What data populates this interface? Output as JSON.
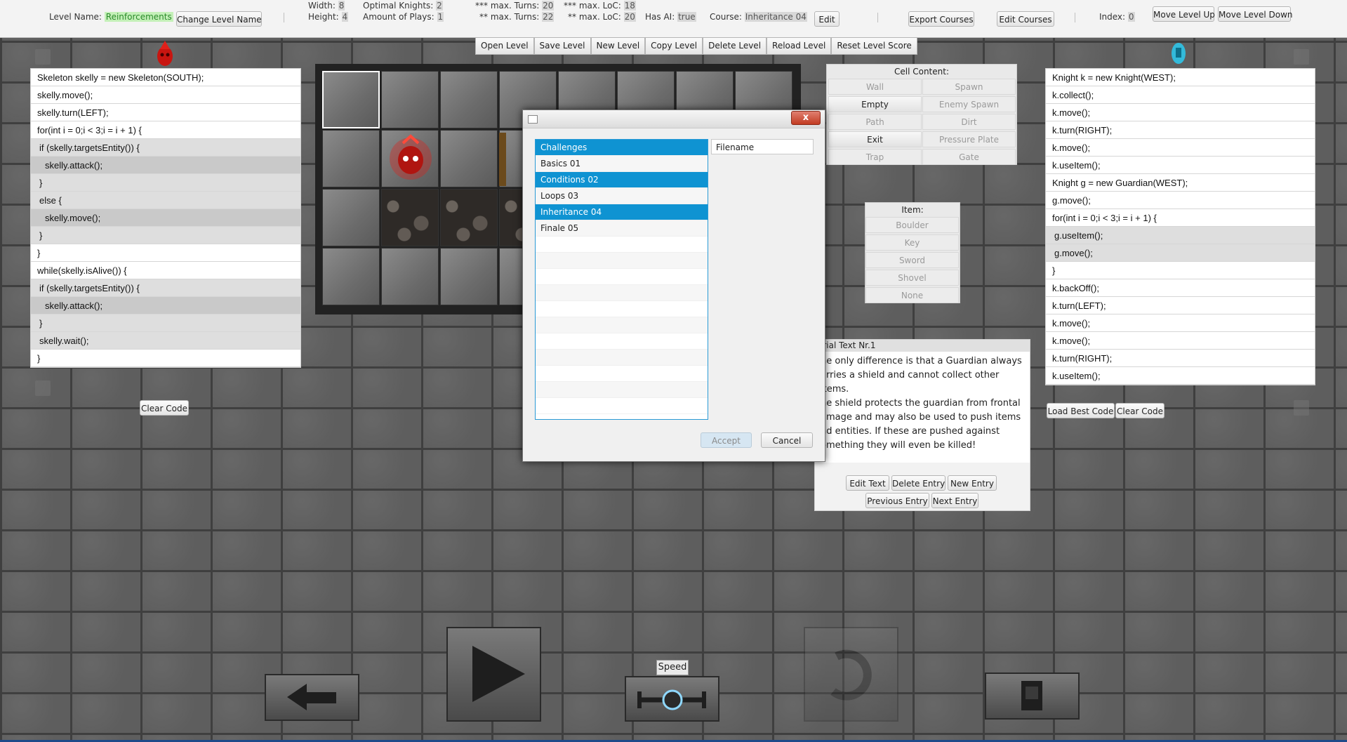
{
  "topbar": {
    "level_name_label": "Level Name:",
    "level_name_value": "Reinforcements",
    "change_level_name": "Change Level Name",
    "width_label": "Width:",
    "width_value": "8",
    "height_label": "Height:",
    "height_value": "4",
    "optimal_knights_label": "Optimal Knights:",
    "optimal_knights_value": "2",
    "amount_plays_label": "Amount of Plays:",
    "amount_plays_value": "1",
    "max_turns3_label": "*** max. Turns:",
    "max_turns3_value": "20",
    "max_turns2_label": "** max. Turns:",
    "max_turns2_value": "22",
    "max_loc3_label": "*** max. LoC:",
    "max_loc3_value": "18",
    "max_loc2_label": "** max. LoC:",
    "max_loc2_value": "20",
    "has_ai_label": "Has AI:",
    "has_ai_value": "true",
    "course_label": "Course:",
    "course_value": "Inheritance 04",
    "edit": "Edit",
    "export_courses": "Export Courses",
    "edit_courses": "Edit Courses",
    "index_label": "Index:",
    "index_value": "0",
    "move_level_up": "Move Level Up",
    "move_level_down": "Move Level Down"
  },
  "toolbar": [
    "Open Level",
    "Save Level",
    "New Level",
    "Copy Level",
    "Delete Level",
    "Reload Level",
    "Reset Level Score"
  ],
  "left_code": [
    {
      "text": "Skeleton skelly = new Skeleton(SOUTH);",
      "indent": 0
    },
    {
      "text": "skelly.move();",
      "indent": 0
    },
    {
      "text": "skelly.turn(LEFT);",
      "indent": 0
    },
    {
      "text": "for(int i = 0;i < 3;i = i + 1) {",
      "indent": 0
    },
    {
      "text": "if (skelly.targetsEntity()) {",
      "indent": 1
    },
    {
      "text": "skelly.attack();",
      "indent": 2
    },
    {
      "text": "}",
      "indent": 1
    },
    {
      "text": "else {",
      "indent": 1
    },
    {
      "text": "skelly.move();",
      "indent": 2
    },
    {
      "text": "}",
      "indent": 1
    },
    {
      "text": "}",
      "indent": 0
    },
    {
      "text": "while(skelly.isAlive()) {",
      "indent": 0
    },
    {
      "text": "if (skelly.targetsEntity()) {",
      "indent": 1
    },
    {
      "text": "skelly.attack();",
      "indent": 2
    },
    {
      "text": "}",
      "indent": 1
    },
    {
      "text": "skelly.wait();",
      "indent": 1
    },
    {
      "text": "}",
      "indent": 0
    }
  ],
  "left_clear_code": "Clear Code",
  "right_code": [
    {
      "text": "Knight k = new Knight(WEST);",
      "indent": 0
    },
    {
      "text": "k.collect();",
      "indent": 0
    },
    {
      "text": "k.move();",
      "indent": 0
    },
    {
      "text": "k.turn(RIGHT);",
      "indent": 0
    },
    {
      "text": "k.move();",
      "indent": 0
    },
    {
      "text": "k.useItem();",
      "indent": 0
    },
    {
      "text": "Knight g = new Guardian(WEST);",
      "indent": 0
    },
    {
      "text": "g.move();",
      "indent": 0
    },
    {
      "text": "for(int i = 0;i < 3;i = i + 1) {",
      "indent": 0
    },
    {
      "text": "g.useItem();",
      "indent": 1
    },
    {
      "text": "g.move();",
      "indent": 1
    },
    {
      "text": "}",
      "indent": 0
    },
    {
      "text": "k.backOff();",
      "indent": 0
    },
    {
      "text": "k.turn(LEFT);",
      "indent": 0
    },
    {
      "text": "k.move();",
      "indent": 0
    },
    {
      "text": "k.move();",
      "indent": 0
    },
    {
      "text": "k.turn(RIGHT);",
      "indent": 0
    },
    {
      "text": "k.useItem();",
      "indent": 0
    }
  ],
  "load_best_code": "Load Best Code",
  "right_clear_code": "Clear Code",
  "cell_content": {
    "title": "Cell Content:",
    "buttons": [
      {
        "label": "Wall",
        "active": false
      },
      {
        "label": "Spawn",
        "active": false
      },
      {
        "label": "Empty",
        "active": true
      },
      {
        "label": "Enemy Spawn",
        "active": false
      },
      {
        "label": "Path",
        "active": false
      },
      {
        "label": "Dirt",
        "active": false
      },
      {
        "label": "Exit",
        "active": true
      },
      {
        "label": "Pressure Plate",
        "active": false
      },
      {
        "label": "Trap",
        "active": false
      },
      {
        "label": "Gate",
        "active": false
      }
    ]
  },
  "item": {
    "title": "Item:",
    "buttons": [
      "Boulder",
      "Key",
      "Sword",
      "Shovel",
      "None"
    ]
  },
  "tutorial": {
    "title": "orial Text Nr.1",
    "lines": [
      "he only difference is that a Guardian always",
      "arries a shield and cannot collect other items.",
      "he shield protects the guardian from frontal",
      "amage and may also be used to push items",
      "nd entities. If these are pushed against",
      "omething they will even be killed!"
    ],
    "edit_text": "Edit Text",
    "delete_entry": "Delete Entry",
    "new_entry": "New Entry",
    "previous_entry": "Previous Entry",
    "next_entry": "Next Entry"
  },
  "dialog": {
    "close": "x",
    "items": [
      {
        "label": "Challenges",
        "selected": true
      },
      {
        "label": "Basics 01",
        "selected": false
      },
      {
        "label": "Conditions 02",
        "selected": true
      },
      {
        "label": "Loops 03",
        "selected": false
      },
      {
        "label": "Inheritance 04",
        "selected": true
      },
      {
        "label": "Finale 05",
        "selected": false
      }
    ],
    "filename_placeholder": "Filename",
    "accept": "Accept",
    "cancel": "Cancel"
  },
  "speed_label": "Speed",
  "colors": {
    "selection": "#0f93d2",
    "level_name_bg": "#c4f0b8",
    "knight_glow": "#2fc4e8",
    "skeleton_red": "#e0201a"
  }
}
